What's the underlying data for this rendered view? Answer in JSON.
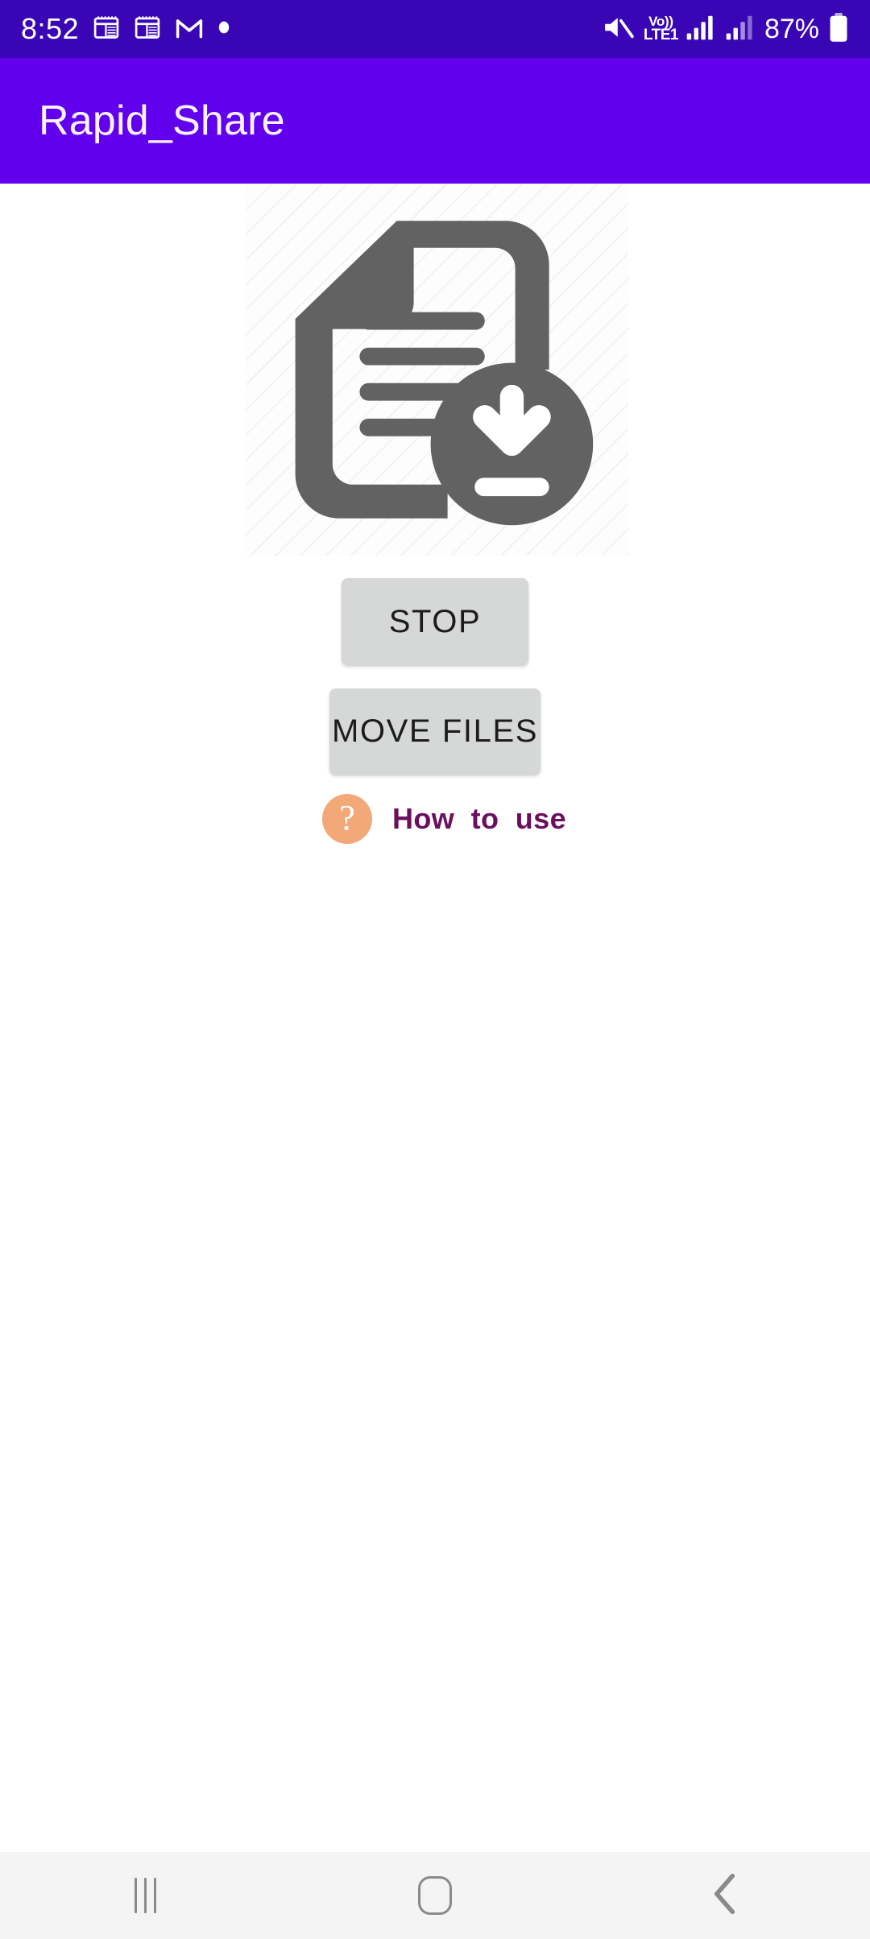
{
  "status_bar": {
    "time": "8:52",
    "icons": [
      "calendar-icon",
      "calendar-icon",
      "gmail-icon",
      "dot-icon"
    ],
    "mute_icon": "mute-icon",
    "volte_top": "Vo))",
    "volte_bottom": "LTE1",
    "signal_icon_1": "signal-bars-icon",
    "signal_icon_2": "signal-bars-icon",
    "battery_percent": "87%",
    "battery_icon": "battery-icon",
    "background_color": "#3A06B5"
  },
  "app_bar": {
    "title": "Rapid_Share",
    "background_color": "#6200EE",
    "title_color": "#FBF3FB"
  },
  "main": {
    "document_icon": {
      "name": "document-download-icon",
      "color": "#626262",
      "placeholder_background": "hatched"
    },
    "buttons": [
      {
        "name": "stop-button",
        "label": "STOP",
        "background_color": "#D6D7D7",
        "text_color": "#1C1C1C"
      },
      {
        "name": "move-files-button",
        "label": "MOVE FILES",
        "background_color": "#D6D7D7",
        "text_color": "#1C1C1C"
      }
    ],
    "how_to_use": {
      "icon": "question-mark-icon",
      "icon_symbol": "?",
      "icon_background_color": "#F2A877",
      "label": "How to use",
      "label_color": "#6B0F5E"
    }
  },
  "nav_bar": {
    "background_color": "#F4F4F4",
    "icon_color": "#8A8A8A",
    "buttons": [
      {
        "name": "recents-button",
        "icon": "recents-icon"
      },
      {
        "name": "home-button",
        "icon": "home-icon"
      },
      {
        "name": "back-button",
        "icon": "back-chevron-icon"
      }
    ]
  }
}
